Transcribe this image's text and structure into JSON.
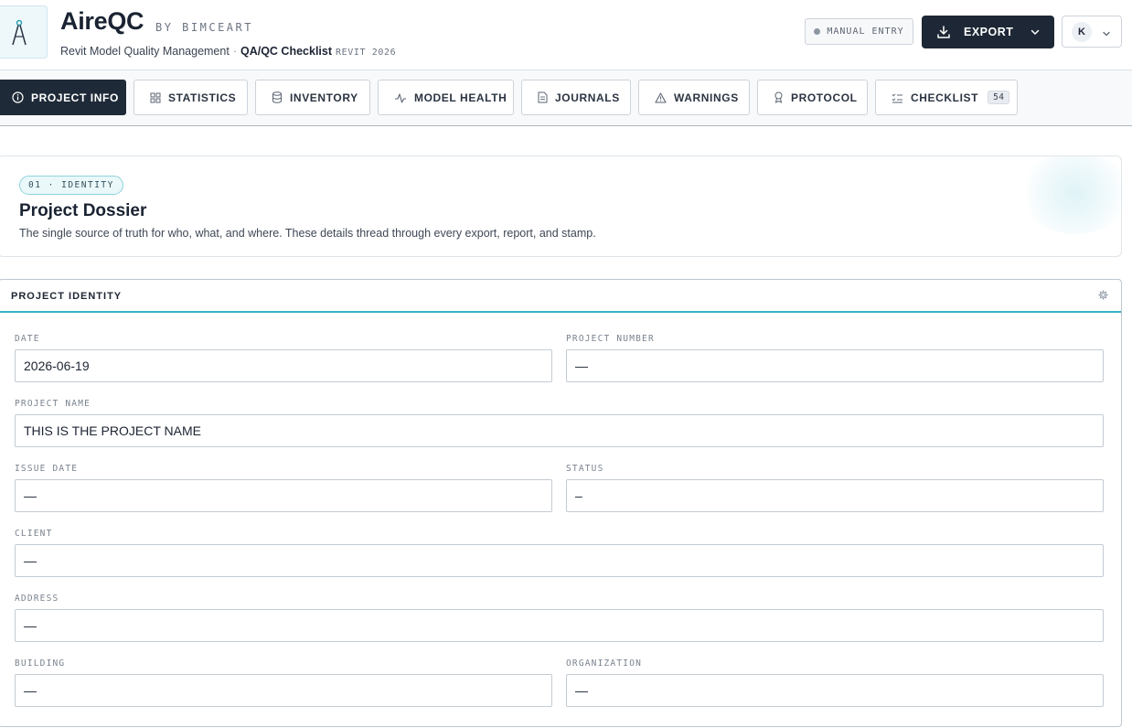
{
  "header": {
    "app_name": "AireQC",
    "by_line": "BY BIMCEART",
    "subtitle": "Revit Model Quality Management",
    "separator": "·",
    "checklist_label": "QA/QC Checklist",
    "revit_version": "REVIT 2026",
    "manual_entry_label": "MANUAL ENTRY",
    "export_label": "EXPORT",
    "user_initial": "K"
  },
  "tabs": [
    {
      "label": "PROJECT INFO",
      "icon": "info-icon",
      "active": true
    },
    {
      "label": "STATISTICS",
      "icon": "grid-icon",
      "active": false
    },
    {
      "label": "INVENTORY",
      "icon": "database-icon",
      "active": false
    },
    {
      "label": "MODEL HEALTH",
      "icon": "pulse-icon",
      "active": false
    },
    {
      "label": "JOURNALS",
      "icon": "document-icon",
      "active": false
    },
    {
      "label": "WARNINGS",
      "icon": "warning-icon",
      "active": false
    },
    {
      "label": "PROTOCOL",
      "icon": "award-icon",
      "active": false
    },
    {
      "label": "CHECKLIST",
      "icon": "checklist-icon",
      "active": false,
      "count": "54"
    }
  ],
  "dossier": {
    "section_tag": "01 · IDENTITY",
    "title": "Project Dossier",
    "description": "The single source of truth for who, what, and where. These details thread through every export, report, and stamp."
  },
  "identity": {
    "panel_title": "PROJECT IDENTITY",
    "fields": {
      "date": {
        "label": "DATE",
        "value": "2026-06-19"
      },
      "project_number": {
        "label": "PROJECT NUMBER",
        "value": "—"
      },
      "project_name": {
        "label": "PROJECT NAME",
        "value": "THIS IS THE PROJECT NAME"
      },
      "issue_date": {
        "label": "ISSUE DATE",
        "value": "—"
      },
      "status": {
        "label": "STATUS",
        "value": "–"
      },
      "client": {
        "label": "CLIENT",
        "value": "—"
      },
      "address": {
        "label": "ADDRESS",
        "value": "—"
      },
      "building": {
        "label": "BUILDING",
        "value": "—"
      },
      "organization": {
        "label": "ORGANIZATION",
        "value": "—"
      }
    }
  },
  "colors": {
    "accent": "#36b2c6",
    "dark": "#1d2735",
    "border": "#c4cbd3"
  }
}
